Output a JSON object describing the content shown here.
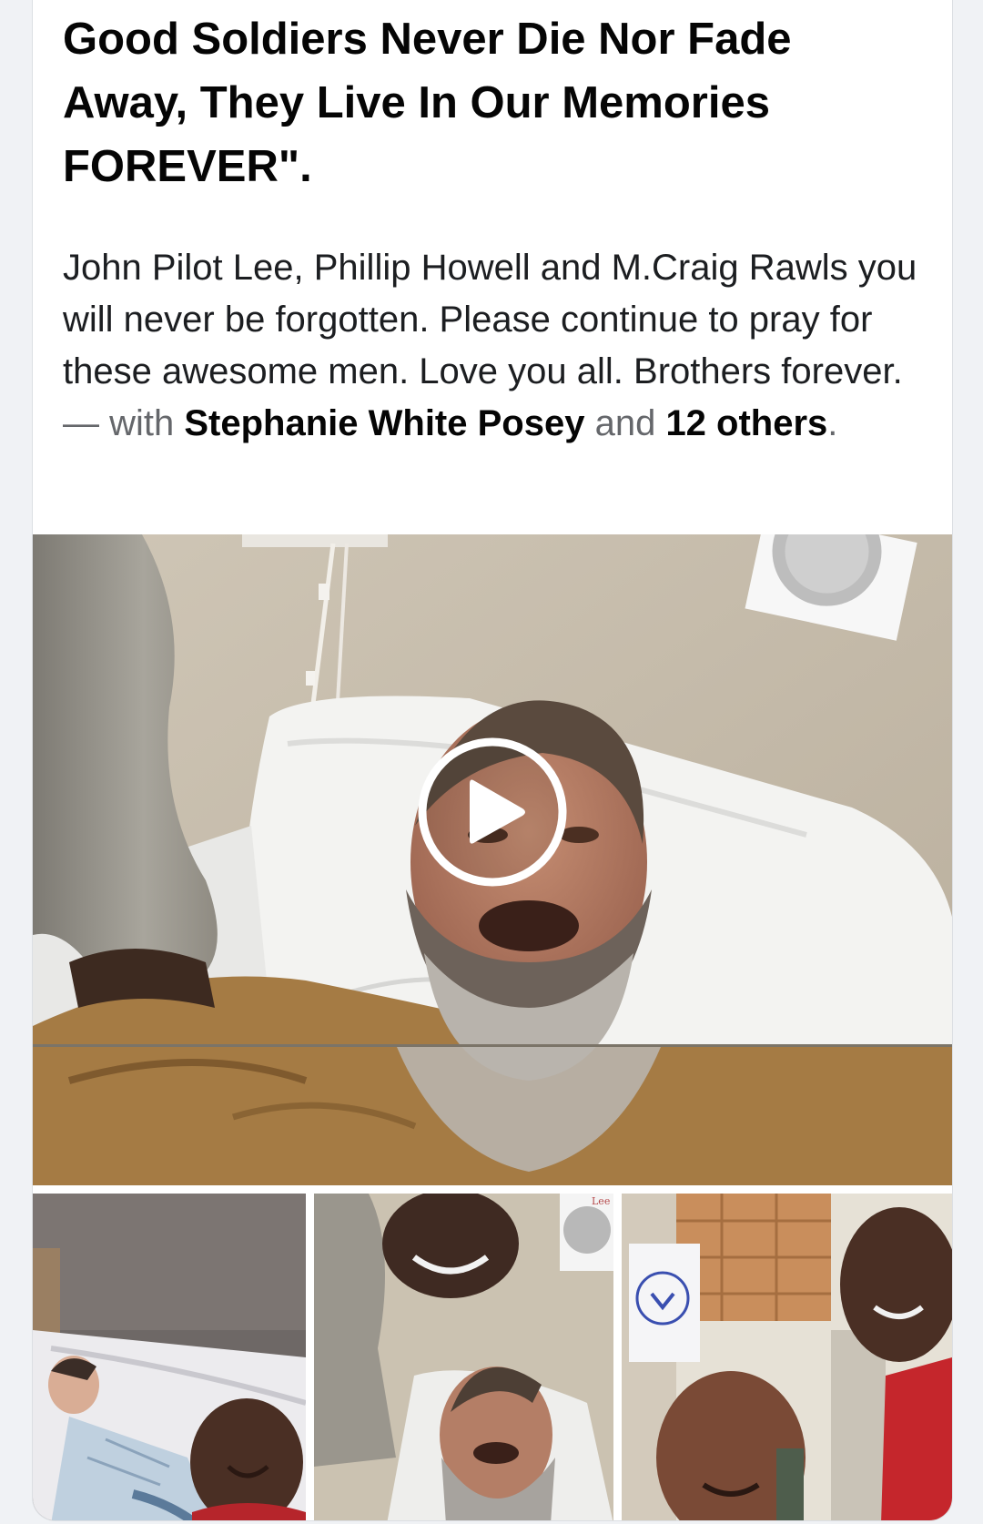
{
  "post": {
    "title": "Good Soldiers Never Die Nor Fade Away, They Live In Our Memories FOREVER\".",
    "body_text": "John Pilot Lee, Phillip Howell and M.Craig Rawls you will never be forgotten. Please continue to pray for these awesome men. Love you all. Brothers forever.",
    "with_separator": " — with ",
    "tagged_person": "Stephanie White Posey",
    "and_word": " and ",
    "others_link": "12 others",
    "end_period": "."
  },
  "media": {
    "main_video": {
      "kind": "video",
      "icon": "play-icon"
    },
    "thumb_1": {
      "kind": "photo",
      "description_icon": "photo"
    },
    "thumb_2": {
      "kind": "photo",
      "clock_label": "Lee"
    },
    "thumb_3": {
      "kind": "photo"
    }
  },
  "colors": {
    "text_primary": "#050505",
    "text_secondary": "#65676b",
    "card_bg": "#ffffff",
    "page_bg": "#f0f2f5"
  }
}
